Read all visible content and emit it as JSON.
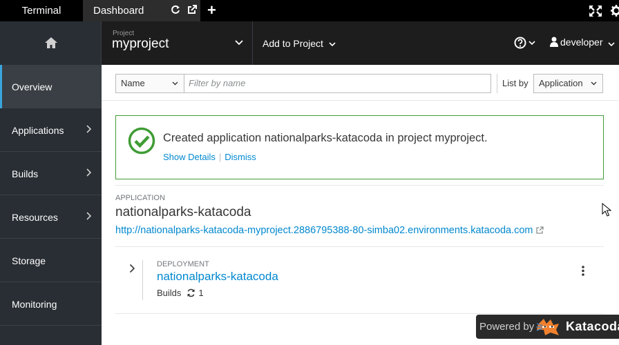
{
  "tabs": {
    "terminal": "Terminal",
    "dashboard": "Dashboard"
  },
  "header": {
    "project_small_label": "Project",
    "project_name": "myproject",
    "add_to_project": "Add to Project",
    "user": "developer"
  },
  "sidebar": {
    "items": [
      {
        "label": "Overview"
      },
      {
        "label": "Applications"
      },
      {
        "label": "Builds"
      },
      {
        "label": "Resources"
      },
      {
        "label": "Storage"
      },
      {
        "label": "Monitoring"
      }
    ]
  },
  "filter": {
    "name_select": "Name",
    "placeholder": "Filter by name",
    "list_by_label": "List by",
    "list_by_value": "Application"
  },
  "alert": {
    "message": "Created application nationalparks-katacoda in project myproject.",
    "show_details": "Show Details",
    "separator": "|",
    "dismiss": "Dismiss"
  },
  "application": {
    "label": "APPLICATION",
    "name": "nationalparks-katacoda",
    "url": "http://nationalparks-katacoda-myproject.2886795388-80-simba02.environments.katacoda.com"
  },
  "deployment": {
    "label": "DEPLOYMENT",
    "name": "nationalparks-katacoda",
    "builds_label": "Builds",
    "builds_count": "1"
  },
  "powered": {
    "prefix": "Powered by",
    "brand": "Katacoda"
  },
  "colors": {
    "accent": "#39a5dc",
    "link": "#0088ce",
    "success": "#3f9c35",
    "sidebar": "#292e34"
  }
}
